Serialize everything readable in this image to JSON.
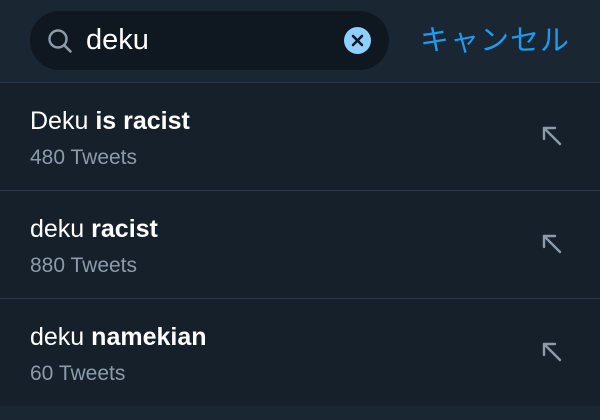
{
  "search": {
    "query": "deku",
    "cancel_label": "キャンセル"
  },
  "suggestions": [
    {
      "prefix": "Deku",
      "highlight": "is racist",
      "count": "480 Tweets"
    },
    {
      "prefix": "deku",
      "highlight": "racist",
      "count": "880 Tweets"
    },
    {
      "prefix": "deku",
      "highlight": "namekian",
      "count": "60 Tweets"
    }
  ],
  "colors": {
    "background": "#15202b",
    "accent": "#1d9bf0",
    "clear_button": "#8ed0ff",
    "secondary_text": "#8d9aa8"
  },
  "icons": {
    "search": "search-icon",
    "clear": "clear-icon",
    "fill_query": "arrow-up-left-icon"
  }
}
